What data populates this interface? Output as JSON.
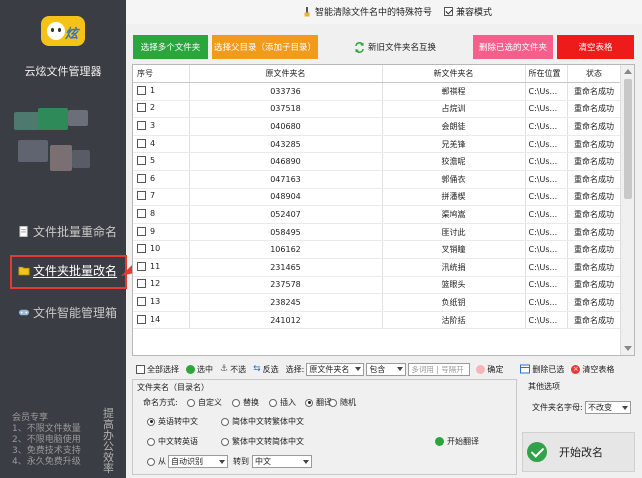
{
  "app": {
    "name": "云炫文件管理器"
  },
  "sidebar": {
    "items": [
      {
        "label": "文件批量重命名",
        "icon": "document-icon"
      },
      {
        "label": "文件夹批量改名",
        "icon": "folder-icon",
        "active": true
      },
      {
        "label": "文件智能管理箱",
        "icon": "gamepad-icon"
      }
    ],
    "promo": {
      "title": "会员专享",
      "lines": [
        "1、不限文件数量",
        "2、不限电脑使用",
        "3、免费技术支持",
        "4、永久免费升级"
      ],
      "side": "提高办公效率"
    }
  },
  "topbar": {
    "smart_clear": "智能清除文件名中的特殊符号",
    "compat_mode": "兼容模式"
  },
  "toolbar": {
    "add_files": "选择多个文件夹",
    "add_dir": "选择父目录（添加子目录）",
    "swap": "新旧文件夹名互换",
    "delete_selected": "删除已选的文件夹",
    "clear_table": "清空表格",
    "colors": {
      "green": "#2aa63c",
      "orange": "#f29a1c",
      "pink": "#f65f8c",
      "red": "#ee1b1b"
    }
  },
  "table": {
    "headers": [
      "序号",
      "原文件夹名",
      "新文件夹名",
      "所在位置",
      "状态"
    ],
    "rows": [
      {
        "no": "1",
        "orig": "033736",
        "new": "郸祺程",
        "loc": "C:\\Us...",
        "status": "重命名成功"
      },
      {
        "no": "2",
        "orig": "037518",
        "new": "占烷训",
        "loc": "C:\\Us...",
        "status": "重命名成功"
      },
      {
        "no": "3",
        "orig": "040680",
        "new": "会朗徒",
        "loc": "C:\\Us...",
        "status": "重命名成功"
      },
      {
        "no": "4",
        "orig": "043285",
        "new": "兄羌锋",
        "loc": "C:\\Us...",
        "status": "重命名成功"
      },
      {
        "no": "5",
        "orig": "046890",
        "new": "狡澹呢",
        "loc": "C:\\Us...",
        "status": "重命名成功"
      },
      {
        "no": "6",
        "orig": "047163",
        "new": "郭俑衣",
        "loc": "C:\\Us...",
        "status": "重命名成功"
      },
      {
        "no": "7",
        "orig": "048904",
        "new": "拼潘楔",
        "loc": "C:\\Us...",
        "status": "重命名成功"
      },
      {
        "no": "8",
        "orig": "052407",
        "new": "渠鸠嵩",
        "loc": "C:\\Us...",
        "status": "重命名成功"
      },
      {
        "no": "9",
        "orig": "058495",
        "new": "匪讨此",
        "loc": "C:\\Us...",
        "status": "重命名成功"
      },
      {
        "no": "10",
        "orig": "106162",
        "new": "叉销瞳",
        "loc": "C:\\Us...",
        "status": "重命名成功"
      },
      {
        "no": "11",
        "orig": "231465",
        "new": "汛统捐",
        "loc": "C:\\Us...",
        "status": "重命名成功"
      },
      {
        "no": "12",
        "orig": "237578",
        "new": "篮眼头",
        "loc": "C:\\Us...",
        "status": "重命名成功"
      },
      {
        "no": "13",
        "orig": "238245",
        "new": "负纸钥",
        "loc": "C:\\Us...",
        "status": "重命名成功"
      },
      {
        "no": "14",
        "orig": "241012",
        "new": "沽阶括",
        "loc": "C:\\Us...",
        "status": "重命名成功"
      }
    ]
  },
  "selection": {
    "select_all": "全部选择",
    "select": "选中",
    "unselect": "不选",
    "invert": "反选",
    "choose_label": "选择:",
    "field": "原文件夹名",
    "match": "包含",
    "query_placeholder": "多词用 | 号隔开",
    "confirm": "确定",
    "delete_selected": "删除已选",
    "clear_table": "清空表格"
  },
  "options": {
    "panel_title": "文件夹名（目录名）",
    "mode_label": "命名方式:",
    "modes": [
      "自定义",
      "替换",
      "插入",
      "翻译",
      "随机"
    ],
    "mode_selected": "翻译",
    "translations": [
      "英语转中文",
      "简体中文转繁体中文",
      "中文转英语",
      "繁体中文转简体中文"
    ],
    "translation_selected": "英语转中文",
    "from_label": "从",
    "from_value": "自动识别",
    "to_label": "转到",
    "to_value": "中文",
    "start_translate": "开始翻译"
  },
  "other": {
    "title": "其他选项",
    "case_label": "文件夹名字母:",
    "case_value": "不改变",
    "start": "开始改名"
  }
}
